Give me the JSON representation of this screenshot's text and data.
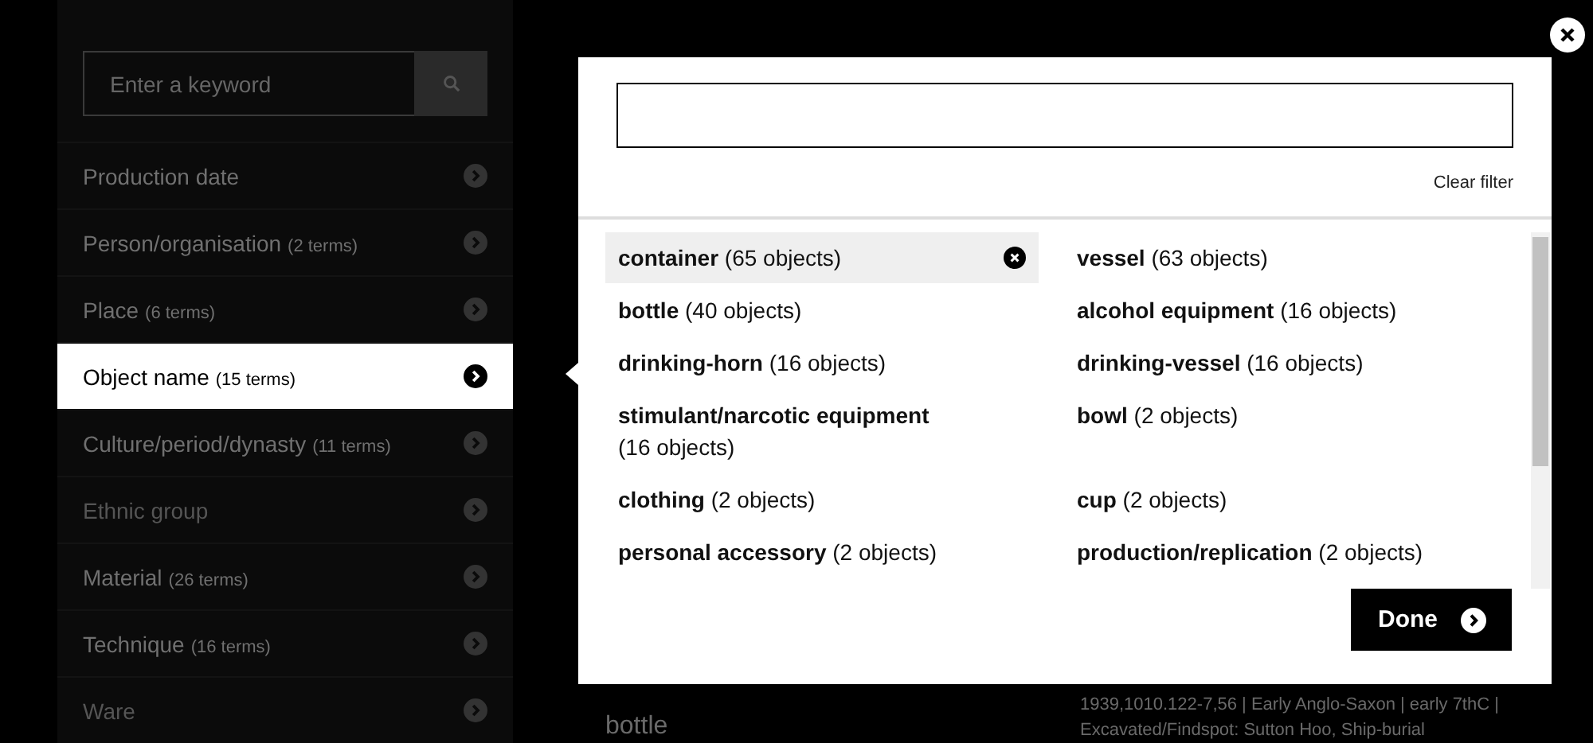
{
  "sidebar": {
    "search": {
      "placeholder": "Enter a keyword"
    },
    "items": [
      {
        "label": "Production date",
        "selected": false,
        "disabled": false
      },
      {
        "label": "Person/organisation",
        "count": "(2 terms)",
        "selected": false,
        "disabled": false
      },
      {
        "label": "Place",
        "count": "(6 terms)",
        "selected": false,
        "disabled": false
      },
      {
        "label": "Object name",
        "count": "(15 terms)",
        "selected": true,
        "disabled": false
      },
      {
        "label": "Culture/period/dynasty",
        "count": "(11 terms)",
        "selected": false,
        "disabled": false
      },
      {
        "label": "Ethnic group",
        "selected": false,
        "disabled": true
      },
      {
        "label": "Material",
        "count": "(26 terms)",
        "selected": false,
        "disabled": false
      },
      {
        "label": "Technique",
        "count": "(16 terms)",
        "selected": false,
        "disabled": false
      },
      {
        "label": "Ware",
        "selected": false,
        "disabled": true
      }
    ]
  },
  "background": {
    "heading": "bottle",
    "record": "1939,1010.122-7,56  |  Early Anglo-Saxon  |  early 7thC  |  Excavated/Findspot: Sutton Hoo, Ship-burial"
  },
  "modal": {
    "clear_filter": "Clear filter",
    "done": "Done",
    "terms": [
      {
        "name": "container",
        "count": "(65 objects)",
        "selected": true
      },
      {
        "name": "vessel",
        "count": "(63 objects)",
        "selected": false
      },
      {
        "name": "bottle",
        "count": "(40 objects)",
        "selected": false
      },
      {
        "name": "alcohol equipment",
        "count": "(16 objects)",
        "selected": false
      },
      {
        "name": "drinking-horn",
        "count": "(16 objects)",
        "selected": false
      },
      {
        "name": "drinking-vessel",
        "count": "(16 objects)",
        "selected": false
      },
      {
        "name": "stimulant/narcotic equipment",
        "count": "(16 objects)",
        "selected": false
      },
      {
        "name": "bowl",
        "count": "(2 objects)",
        "selected": false
      },
      {
        "name": "clothing",
        "count": "(2 objects)",
        "selected": false
      },
      {
        "name": "cup",
        "count": "(2 objects)",
        "selected": false
      },
      {
        "name": "personal accessory",
        "count": "(2 objects)",
        "selected": false
      },
      {
        "name": "production/replication",
        "count": "(2 objects)",
        "selected": false
      }
    ]
  }
}
